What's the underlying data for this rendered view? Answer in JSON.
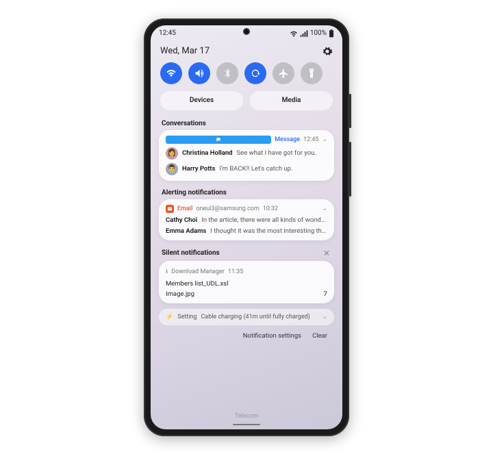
{
  "status": {
    "time": "12:45",
    "battery": "100%"
  },
  "header": {
    "date": "Wed, Mar 17"
  },
  "qs": {
    "icons": [
      "wifi",
      "volume",
      "bluetooth",
      "rotate",
      "airplane",
      "flashlight"
    ],
    "devices_label": "Devices",
    "media_label": "Media"
  },
  "sections": {
    "conversations": "Conversations",
    "alerting": "Alerting notifications",
    "silent": "Silent notifications"
  },
  "convo_card": {
    "app": "Message",
    "time": "12:45",
    "rows": [
      {
        "name": "Christina Holland",
        "msg": "See what I have got for you."
      },
      {
        "name": "Harry Potts",
        "msg": "I'm BACK!! Let's catch up."
      }
    ]
  },
  "email_card": {
    "app": "Email",
    "account": "oneui3@samsung.com",
    "time": "10:32",
    "rows": [
      {
        "name": "Cathy Choi",
        "msg": "In the article, there were all kinds of wond…"
      },
      {
        "name": "Emma Adams",
        "msg": "I thought it was the most interesting th…"
      }
    ]
  },
  "download_card": {
    "app": "Download Manager",
    "time": "11:35",
    "lines": [
      {
        "file": "Members list_UDL.xsl",
        "count": ""
      },
      {
        "file": "Image.jpg",
        "count": "7"
      }
    ]
  },
  "setting_row": {
    "app": "Setting",
    "text": "Cable charging (41m until fully charged)"
  },
  "footer": {
    "settings": "Notification settings",
    "clear": "Clear"
  },
  "carrier": "Telecom"
}
